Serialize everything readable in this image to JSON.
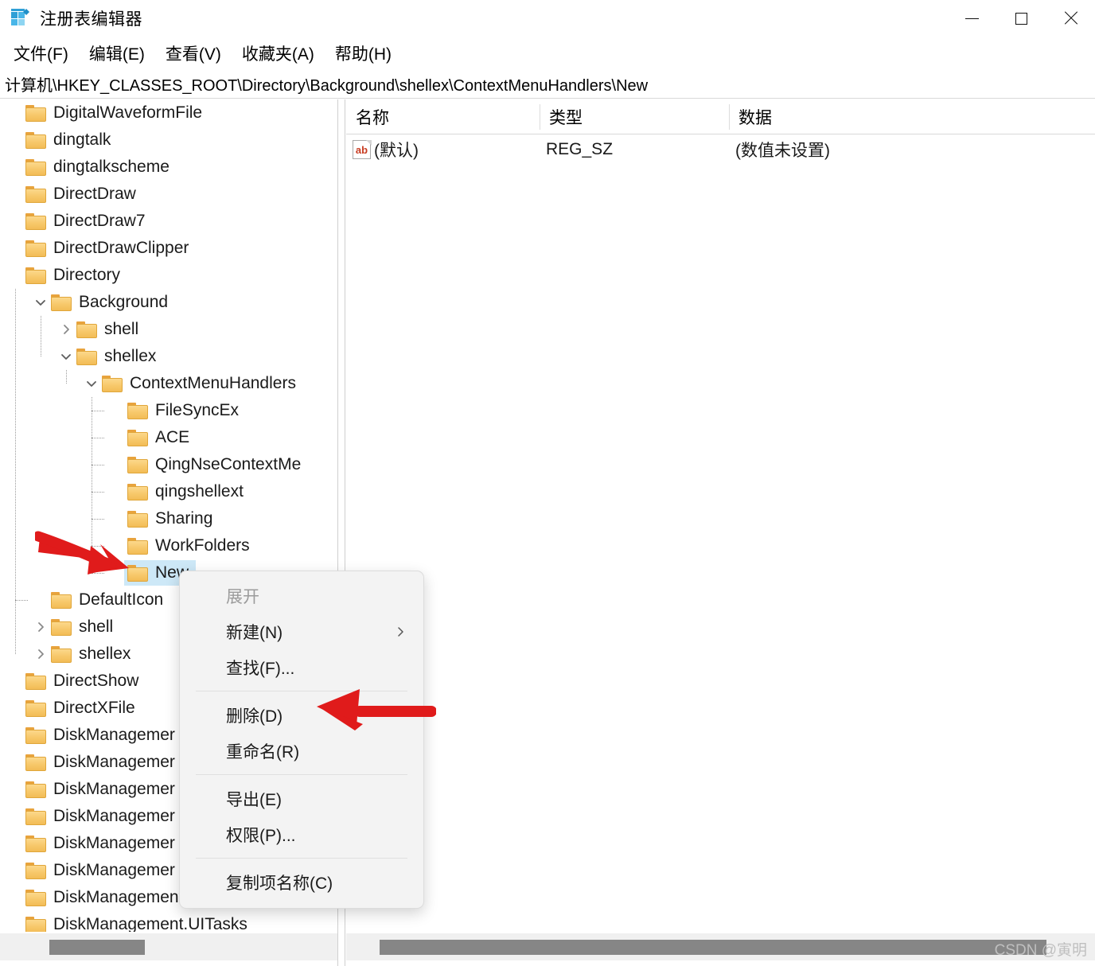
{
  "window": {
    "title": "注册表编辑器",
    "app_icon": "registry-editor-icon",
    "minimize_label": "−",
    "maximize_label": "□",
    "close_label": "✕"
  },
  "menubar": {
    "items": [
      {
        "label": "文件(F)"
      },
      {
        "label": "编辑(E)"
      },
      {
        "label": "查看(V)"
      },
      {
        "label": "收藏夹(A)"
      },
      {
        "label": "帮助(H)"
      }
    ]
  },
  "address": {
    "path": "计算机\\HKEY_CLASSES_ROOT\\Directory\\Background\\shellex\\ContextMenuHandlers\\New"
  },
  "tree": {
    "items": [
      {
        "label": "DigitalWaveformFile",
        "depth": 0,
        "twisty": "none",
        "selected": false
      },
      {
        "label": "dingtalk",
        "depth": 0,
        "twisty": "none",
        "selected": false
      },
      {
        "label": "dingtalkscheme",
        "depth": 0,
        "twisty": "none",
        "selected": false
      },
      {
        "label": "DirectDraw",
        "depth": 0,
        "twisty": "none",
        "selected": false
      },
      {
        "label": "DirectDraw7",
        "depth": 0,
        "twisty": "none",
        "selected": false
      },
      {
        "label": "DirectDrawClipper",
        "depth": 0,
        "twisty": "none",
        "selected": false
      },
      {
        "label": "Directory",
        "depth": 0,
        "twisty": "none",
        "selected": false
      },
      {
        "label": "Background",
        "depth": 1,
        "twisty": "expanded",
        "selected": false
      },
      {
        "label": "shell",
        "depth": 2,
        "twisty": "collapsed",
        "selected": false
      },
      {
        "label": "shellex",
        "depth": 2,
        "twisty": "expanded",
        "selected": false
      },
      {
        "label": "ContextMenuHandlers",
        "depth": 3,
        "twisty": "expanded",
        "selected": false
      },
      {
        "label": "FileSyncEx",
        "depth": 4,
        "twisty": "none",
        "selected": false
      },
      {
        "label": "ACE",
        "depth": 4,
        "twisty": "none",
        "selected": false
      },
      {
        "label": "QingNseContextMe",
        "depth": 4,
        "twisty": "none",
        "selected": false
      },
      {
        "label": "qingshellext",
        "depth": 4,
        "twisty": "none",
        "selected": false
      },
      {
        "label": "Sharing",
        "depth": 4,
        "twisty": "none",
        "selected": false
      },
      {
        "label": "WorkFolders",
        "depth": 4,
        "twisty": "none",
        "selected": false
      },
      {
        "label": "New",
        "depth": 4,
        "twisty": "none",
        "selected": true
      },
      {
        "label": "DefaultIcon",
        "depth": 1,
        "twisty": "none",
        "selected": false
      },
      {
        "label": "shell",
        "depth": 1,
        "twisty": "collapsed",
        "selected": false
      },
      {
        "label": "shellex",
        "depth": 1,
        "twisty": "collapsed",
        "selected": false
      },
      {
        "label": "DirectShow",
        "depth": 0,
        "twisty": "none",
        "selected": false
      },
      {
        "label": "DirectXFile",
        "depth": 0,
        "twisty": "none",
        "selected": false
      },
      {
        "label": "DiskManagemer",
        "depth": 0,
        "twisty": "none",
        "selected": false
      },
      {
        "label": "DiskManagemer",
        "depth": 0,
        "twisty": "none",
        "selected": false
      },
      {
        "label": "DiskManagemer",
        "depth": 0,
        "twisty": "none",
        "selected": false
      },
      {
        "label": "DiskManagemer",
        "depth": 0,
        "twisty": "none",
        "selected": false
      },
      {
        "label": "DiskManagemer",
        "depth": 0,
        "twisty": "none",
        "selected": false
      },
      {
        "label": "DiskManagemer",
        "depth": 0,
        "twisty": "none",
        "selected": false
      },
      {
        "label": "DiskManagement.SnapInExtens",
        "depth": 0,
        "twisty": "none",
        "selected": false
      },
      {
        "label": "DiskManagement.UITasks",
        "depth": 0,
        "twisty": "none",
        "selected": false
      }
    ]
  },
  "list": {
    "columns": [
      {
        "label": "名称"
      },
      {
        "label": "类型"
      },
      {
        "label": "数据"
      }
    ],
    "rows": [
      {
        "icon": "string-value-icon",
        "name": "(默认)",
        "type": "REG_SZ",
        "data": "(数值未设置)"
      }
    ]
  },
  "context_menu": {
    "items": [
      {
        "label": "展开",
        "disabled": true,
        "submenu": false
      },
      {
        "label": "新建(N)",
        "disabled": false,
        "submenu": true
      },
      {
        "label": "查找(F)...",
        "disabled": false,
        "submenu": false
      },
      {
        "separator": true
      },
      {
        "label": "删除(D)",
        "disabled": false,
        "submenu": false
      },
      {
        "label": "重命名(R)",
        "disabled": false,
        "submenu": false
      },
      {
        "separator": true
      },
      {
        "label": "导出(E)",
        "disabled": false,
        "submenu": false
      },
      {
        "label": "权限(P)...",
        "disabled": false,
        "submenu": false
      },
      {
        "separator": true
      },
      {
        "label": "复制项名称(C)",
        "disabled": false,
        "submenu": false
      }
    ]
  },
  "annotations": {
    "arrow_color": "#e01b1b",
    "arrow_tree_target": "New",
    "arrow_menu_target": "删除(D)"
  },
  "watermark": {
    "text": "CSDN @寅明"
  }
}
